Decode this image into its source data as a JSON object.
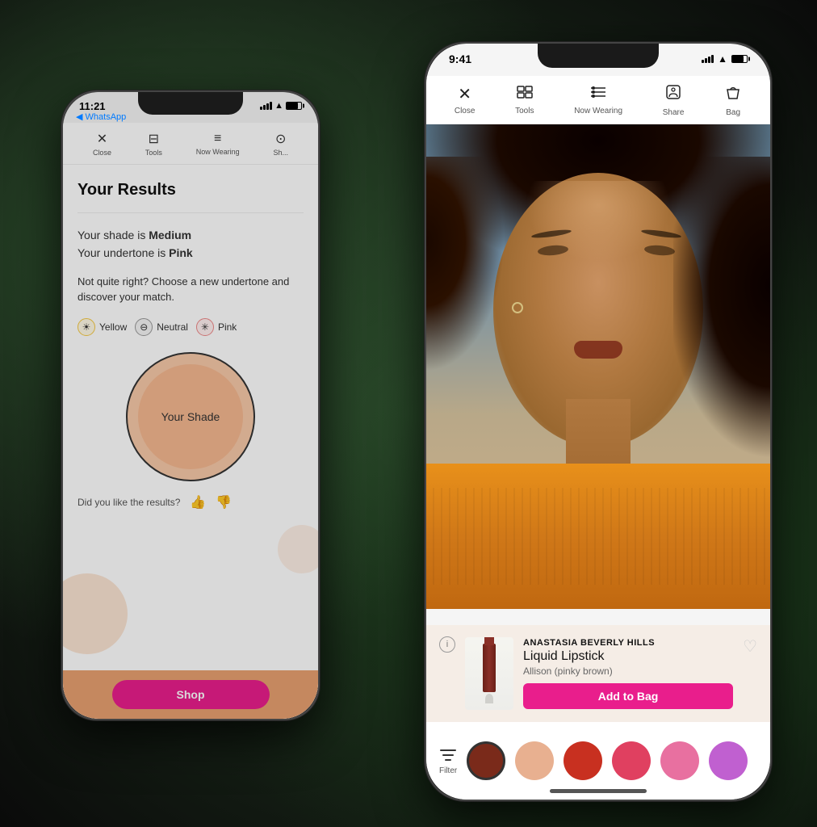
{
  "back_phone": {
    "status_time": "11:21",
    "whatsapp_back_label": "◀ WhatsApp",
    "app_bar": {
      "close_label": "Close",
      "tools_label": "Tools",
      "now_wearing_label": "Now Wearing",
      "share_label": "Sh..."
    },
    "results": {
      "title": "Your Results",
      "shade_line1_prefix": "Your shade is ",
      "shade_line1_bold": "Medium",
      "shade_line2_prefix": "Your undertone is ",
      "shade_line2_bold": "Pink",
      "choose_text": "Not quite right? Choose a new undertone and discover your match.",
      "undertones": [
        {
          "name": "Yellow",
          "icon": "☀"
        },
        {
          "name": "Neutral",
          "icon": "⊖"
        },
        {
          "name": "Pink",
          "icon": "✳"
        }
      ],
      "shade_circle_label": "Your Shade",
      "feedback_text": "Did you like the results?",
      "thumbs_up": "👍",
      "thumbs_down": "👎"
    }
  },
  "front_phone": {
    "status_time": "9:41",
    "app_bar": {
      "close_label": "Close",
      "tools_label": "Tools",
      "now_wearing_label": "Now Wearing",
      "share_label": "Share",
      "bag_label": "Bag"
    },
    "product": {
      "brand": "ANASTASIA BEVERLY HILLS",
      "name": "Liquid Lipstick",
      "shade": "Allison (pinky brown)",
      "add_to_bag_label": "Add to Bag",
      "info_icon": "i"
    },
    "swatches": [
      {
        "color": "#7a2a1a",
        "selected": true
      },
      {
        "color": "#e8b090",
        "selected": false
      },
      {
        "color": "#c83020",
        "selected": false
      },
      {
        "color": "#e04060",
        "selected": false
      },
      {
        "color": "#e870a0",
        "selected": false
      },
      {
        "color": "#c060d0",
        "selected": false
      }
    ],
    "filter_label": "Filter"
  }
}
